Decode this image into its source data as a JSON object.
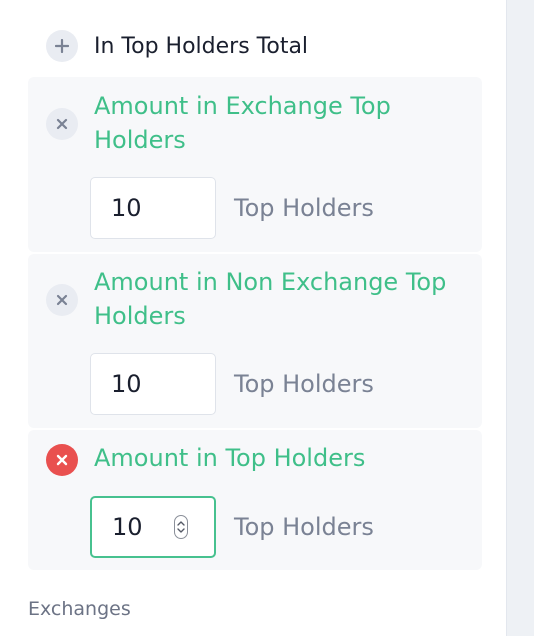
{
  "top_item": {
    "label": "In Top Holders Total",
    "icon": "plus-icon"
  },
  "cards": [
    {
      "title": "Amount in Exchange Top Holders",
      "remove_icon": "close-icon",
      "input_value": "10",
      "unit_label": "Top Holders"
    },
    {
      "title": "Amount in Non Exchange Top Holders",
      "remove_icon": "close-icon",
      "input_value": "10",
      "unit_label": "Top Holders"
    },
    {
      "title": "Amount in Top Holders",
      "remove_icon": "close-icon",
      "input_value": "10",
      "unit_label": "Top Holders",
      "focused": true
    }
  ],
  "section": {
    "title": "Exchanges"
  },
  "colors": {
    "accent": "#3fbf89",
    "danger": "#e9504f",
    "muted": "#7a8294"
  }
}
